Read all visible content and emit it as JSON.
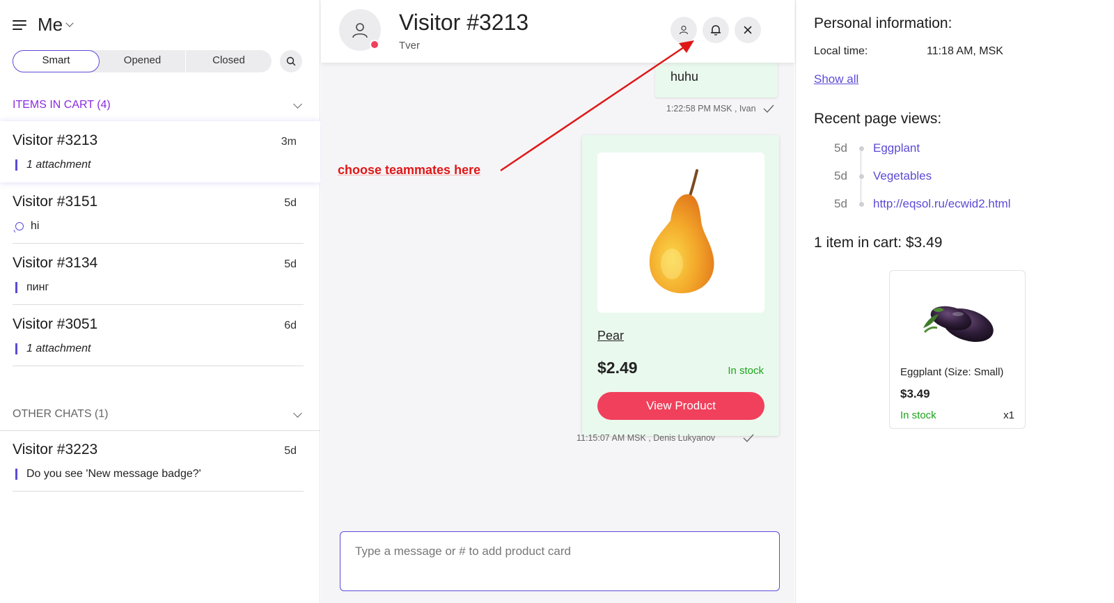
{
  "left": {
    "title": "Me",
    "filters": [
      "Smart",
      "Opened",
      "Closed"
    ],
    "cart_section": "ITEMS IN CART (4)",
    "other_section": "OTHER CHATS (1)",
    "cart_chats": [
      {
        "name": "Visitor #3213",
        "time": "3m",
        "preview": "1 attachment"
      },
      {
        "name": "Visitor #3151",
        "time": "5d",
        "preview": "hi"
      },
      {
        "name": "Visitor #3134",
        "time": "5d",
        "preview": "пинг"
      },
      {
        "name": "Visitor #3051",
        "time": "6d",
        "preview": "1 attachment"
      }
    ],
    "other_chats": [
      {
        "name": "Visitor #3223",
        "time": "5d",
        "preview": "Do you see 'New message badge?'"
      }
    ]
  },
  "center": {
    "visitor_name": "Visitor #3213",
    "visitor_city": "Tver",
    "message_text": "huhu",
    "message_meta": "1:22:58 PM MSK , Ivan",
    "annotation": "choose teammates here",
    "product": {
      "name": "Pear",
      "price": "$2.49",
      "stock": "In stock",
      "button": "View Product"
    },
    "product_meta": "11:15:07 AM MSK , Denis Lukyanov",
    "composer_placeholder": "Type a message or # to add product card"
  },
  "right": {
    "personal_title": "Personal information:",
    "local_time_label": "Local time:",
    "local_time_value": "11:18 AM, MSK",
    "show_all": "Show all",
    "recent_title": "Recent page views:",
    "page_views": [
      {
        "ago": "5d",
        "page": "Eggplant"
      },
      {
        "ago": "5d",
        "page": "Vegetables"
      },
      {
        "ago": "5d",
        "page": "http://eqsol.ru/ecwid2.html"
      }
    ],
    "cart_title": "1 item in cart: $3.49",
    "cart_item": {
      "name": "Eggplant (Size: Small)",
      "price": "$3.49",
      "stock": "In stock",
      "qty": "x1"
    }
  },
  "colors": {
    "accent": "#5b4bd6",
    "cart_section": "#8a2be2",
    "danger": "#f0405c",
    "in_stock": "#1aa51a",
    "annotation": "#e01717",
    "bubble_bg": "#eaf9ee"
  }
}
